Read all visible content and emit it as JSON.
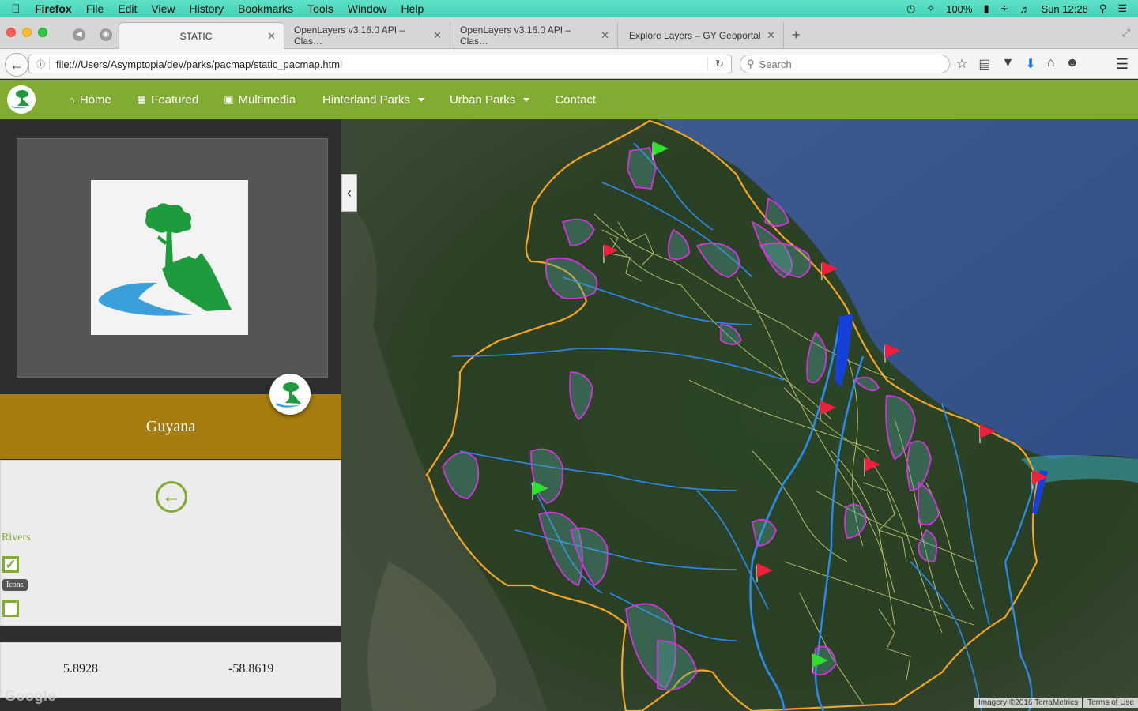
{
  "menubar": {
    "app": "Firefox",
    "items": [
      "File",
      "Edit",
      "View",
      "History",
      "Bookmarks",
      "Tools",
      "Window",
      "Help"
    ],
    "battery": "100%",
    "clock": "Sun 12:28"
  },
  "tabs": [
    {
      "label": "STATIC",
      "active": true
    },
    {
      "label": "OpenLayers v3.16.0 API – Clas…",
      "active": false
    },
    {
      "label": "OpenLayers v3.16.0 API – Clas…",
      "active": false
    },
    {
      "label": "Explore Layers – GY Geoportal",
      "active": false
    }
  ],
  "toolbar": {
    "url": "file:///Users/Asymptopia/dev/parks/pacmap/static_pacmap.html",
    "search_placeholder": "Search"
  },
  "site_nav": {
    "links": [
      {
        "label": "Home",
        "icon": "home-icon"
      },
      {
        "label": "Featured",
        "icon": "film-icon"
      },
      {
        "label": "Multimedia",
        "icon": "image-icon"
      },
      {
        "label": "Hinterland Parks",
        "dropdown": true
      },
      {
        "label": "Urban Parks",
        "dropdown": true
      },
      {
        "label": "Contact"
      }
    ],
    "color": "#82ac31"
  },
  "panel": {
    "title": "Guyana",
    "band_color": "#a77d0f",
    "layers": {
      "rivers_label": "Rivers",
      "rivers_checked": true,
      "icons_tooltip": "Icons",
      "icons_checked": false
    },
    "coords": {
      "lat": "5.8928",
      "lon": "-58.8619"
    },
    "watermark": "Google"
  },
  "map": {
    "attribution": "Imagery ©2016 TerraMetrics",
    "terms": "Terms of Use",
    "colors": {
      "boundary": "#f5a623",
      "rivers": "#1e90ff",
      "roads": "#f4f58c",
      "parks": "#d633e0",
      "flag_red": "#f01f3c",
      "flag_green": "#2fe02f"
    }
  }
}
